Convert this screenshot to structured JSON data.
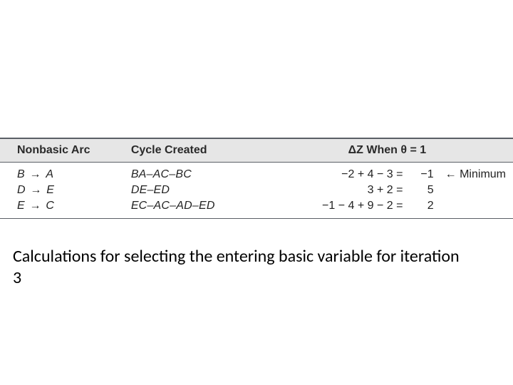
{
  "table": {
    "headers": {
      "arc": "Nonbasic Arc",
      "cycle": "Cycle Created",
      "dz": "ΔZ When θ = 1"
    },
    "rows": [
      {
        "arc_from": "B",
        "arc_to": "A",
        "cycle": "BA–AC–BC",
        "eq": "−2 + 4 − 3 =",
        "val": "−1",
        "note": "← Minimum"
      },
      {
        "arc_from": "D",
        "arc_to": "E",
        "cycle": "DE–ED",
        "eq": "3 + 2 =",
        "val": "5",
        "note": ""
      },
      {
        "arc_from": "E",
        "arc_to": "C",
        "cycle": "EC–AC–AD–ED",
        "eq": "−1 − 4 + 9 − 2 =",
        "val": "2",
        "note": ""
      }
    ]
  },
  "caption": "Calculations for selecting the entering basic variable for iteration 3",
  "arrow_glyph": "→"
}
